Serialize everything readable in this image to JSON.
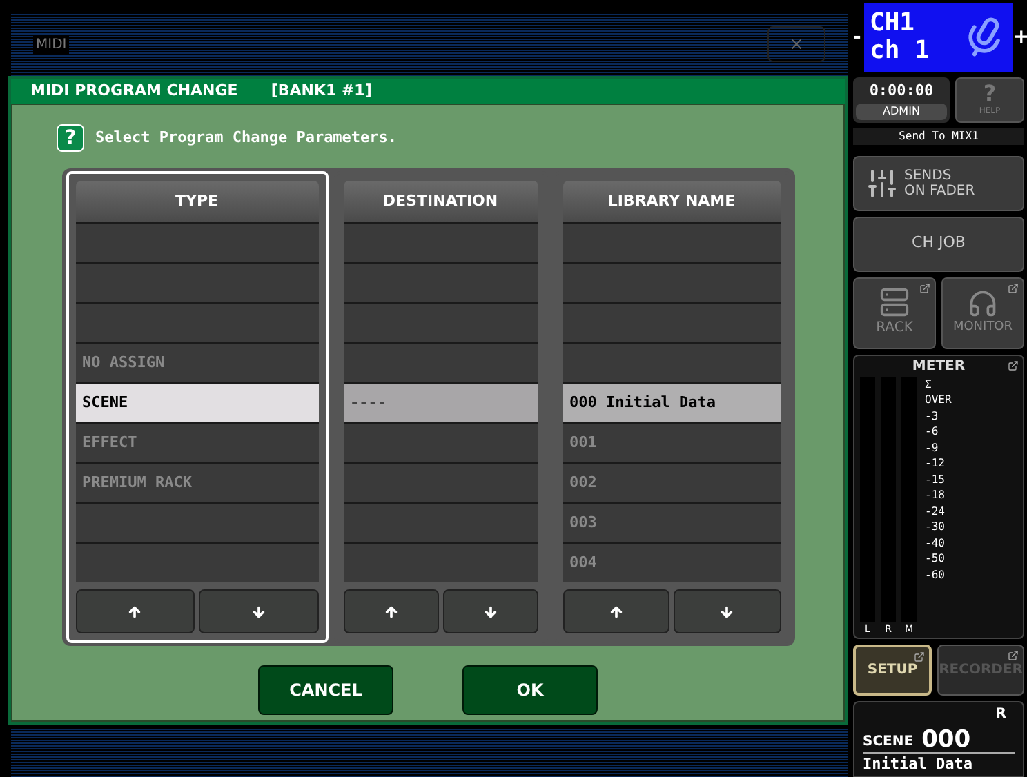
{
  "window": {
    "title": "MIDI"
  },
  "dialog": {
    "title": "MIDI PROGRAM CHANGE",
    "bank": "[BANK1 #1]",
    "help_icon": "?",
    "instruction": "Select Program Change Parameters.",
    "columns": [
      {
        "header": "TYPE",
        "focused": true,
        "rows": [
          {
            "selected": false
          },
          {
            "selected": false
          },
          {
            "selected": false
          },
          {
            "text": "NO ASSIGN",
            "selected": false
          },
          {
            "text": "SCENE",
            "selected": true
          },
          {
            "text": "EFFECT",
            "selected": false
          },
          {
            "text": "PREMIUM RACK",
            "selected": false
          },
          {
            "selected": false
          },
          {
            "selected": false
          }
        ]
      },
      {
        "header": "DESTINATION",
        "focused": false,
        "rows": [
          {
            "selected": false
          },
          {
            "selected": false
          },
          {
            "selected": false
          },
          {
            "selected": false
          },
          {
            "text": "----",
            "selected": true
          },
          {
            "selected": false
          },
          {
            "selected": false
          },
          {
            "selected": false
          },
          {
            "selected": false
          }
        ]
      },
      {
        "header": "LIBRARY NAME",
        "focused": false,
        "rows": [
          {
            "selected": false
          },
          {
            "selected": false
          },
          {
            "selected": false
          },
          {
            "selected": false
          },
          {
            "text": "000 Initial Data",
            "selected": true
          },
          {
            "text": "001",
            "selected": false
          },
          {
            "text": "002",
            "selected": false
          },
          {
            "text": "003",
            "selected": false
          },
          {
            "text": "004",
            "selected": false
          }
        ]
      }
    ],
    "buttons": [
      "CANCEL",
      "OK"
    ]
  },
  "side": {
    "channel": {
      "minus": "-",
      "plus": "+",
      "id": "CH1",
      "name": "ch 1"
    },
    "time": "0:00:00",
    "user": "ADMIN",
    "help": "HELP",
    "send_to": "Send To MIX1",
    "sends_on_fader": [
      "SENDS",
      "ON FADER"
    ],
    "ch_job": "CH JOB",
    "rack": "RACK",
    "monitor": "MONITOR",
    "meter": {
      "title": "METER",
      "sigma": "Σ",
      "scale": [
        "OVER",
        "-3",
        "-6",
        "-9",
        "-12",
        "-15",
        "-18",
        "-24",
        "-30",
        "-40",
        "-50",
        "-60"
      ],
      "channels": [
        "L",
        "R",
        "M"
      ]
    },
    "setup": {
      "label": "SETUP",
      "disabled": false
    },
    "recorder": {
      "label": "RECORDER",
      "disabled": true
    },
    "scene": {
      "label": "SCENE",
      "number": "000",
      "flag": "R",
      "name": "Initial Data"
    }
  }
}
